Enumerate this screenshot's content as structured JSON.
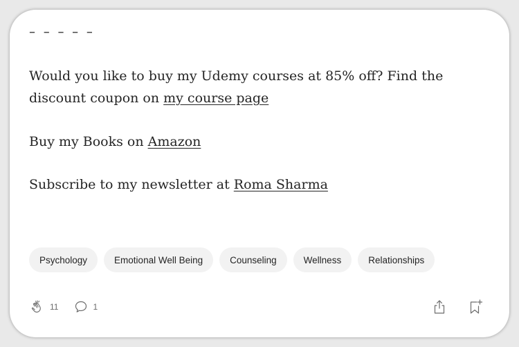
{
  "article": {
    "separator": "– – – – –",
    "p1_text": "Would you like to buy my Udemy courses at 85% off? Find the discount coupon on ",
    "p1_link": "my course page",
    "p2_text": "Buy my Books on ",
    "p2_link": "Amazon",
    "p3_text": "Subscribe to my newsletter at ",
    "p3_link": "Roma Sharma"
  },
  "tags": [
    "Psychology",
    "Emotional Well Being",
    "Counseling",
    "Wellness",
    "Relationships"
  ],
  "footer": {
    "claps_count": "11",
    "responses_count": "1",
    "clap_icon": "clap-icon",
    "response_icon": "speech-bubble-icon",
    "share_icon": "share-icon",
    "bookmark_icon": "bookmark-add-icon"
  }
}
